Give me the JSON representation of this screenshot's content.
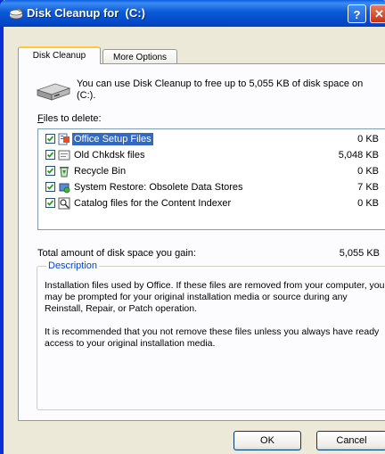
{
  "window": {
    "title": "Disk Cleanup for  (C:)",
    "help_label": "?",
    "close_label": "✕"
  },
  "tabs": [
    {
      "label": "Disk Cleanup",
      "active": true
    },
    {
      "label": "More Options",
      "active": false
    }
  ],
  "intro": {
    "text": "You can use Disk Cleanup to free up to 5,055 KB of disk space on  (C:)."
  },
  "files": {
    "label_prefix": "F",
    "label_rest": "iles to delete:",
    "items": [
      {
        "name": "Office Setup Files",
        "size": "0 KB",
        "checked": true,
        "selected": true,
        "icon": "office-setup-icon"
      },
      {
        "name": "Old Chkdsk files",
        "size": "5,048 KB",
        "checked": true,
        "selected": false,
        "icon": "file-icon"
      },
      {
        "name": "Recycle Bin",
        "size": "0 KB",
        "checked": true,
        "selected": false,
        "icon": "recycle-bin-icon"
      },
      {
        "name": "System Restore: Obsolete Data Stores",
        "size": "7 KB",
        "checked": true,
        "selected": false,
        "icon": "system-restore-icon"
      },
      {
        "name": "Catalog files for the Content Indexer",
        "size": "0 KB",
        "checked": true,
        "selected": false,
        "icon": "catalog-icon"
      }
    ]
  },
  "total": {
    "label": "Total amount of disk space you gain:",
    "value": "5,055 KB"
  },
  "description": {
    "legend": "Description",
    "paragraph1": "Installation files used by Office.  If these files are removed from your computer, you may be prompted for your original installation media or source during any Reinstall, Repair, or Patch operation.",
    "paragraph2": "It is recommended that you not remove these files unless you always have ready access to your original installation media."
  },
  "buttons": {
    "ok": "OK",
    "cancel": "Cancel"
  },
  "colors": {
    "titlebar": "#0a5ad8",
    "selection": "#316ac5",
    "legend": "#0046d5"
  }
}
